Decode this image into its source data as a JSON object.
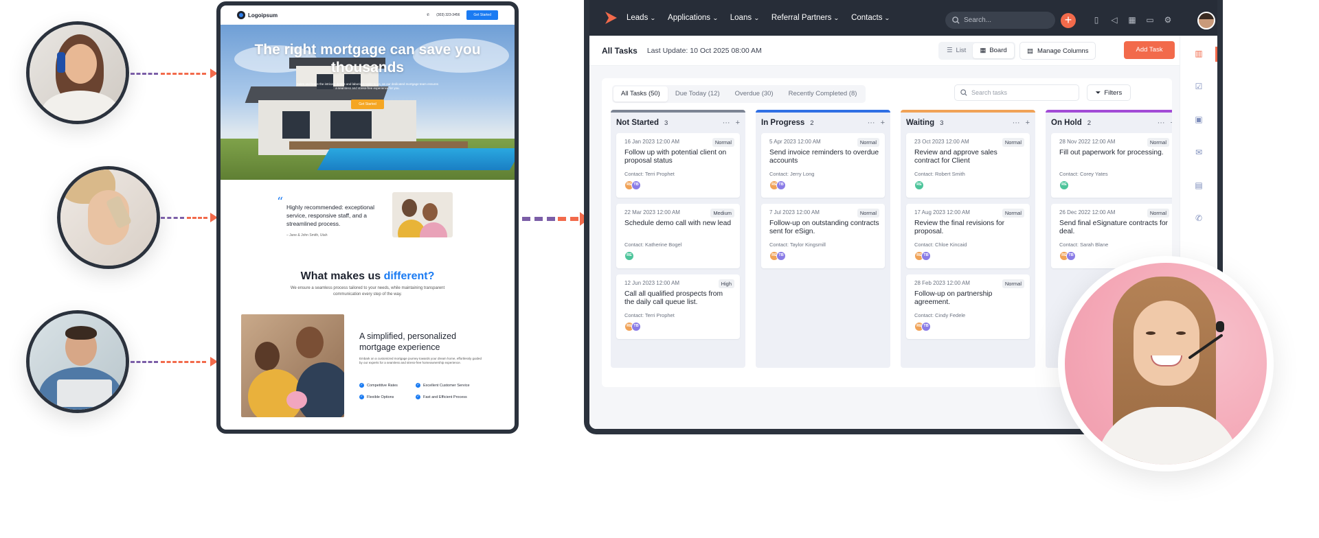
{
  "website": {
    "logo": "Logoipsum",
    "phone": "(303) 323-3456",
    "nav_cta": "Get Started",
    "hero_title": "The right mortgage can save you thousands",
    "hero_subtitle": "Sales and leave the intricate details and laborious tasks to us, as our dedicated mortgage team ensures a seamless and stress-free experience for you.",
    "hero_button": "Get Started",
    "testimonial_quote": "Highly recommended: exceptional service, responsive staff, and a streamlined process.",
    "testimonial_author": "– Jane & John Smith, Utah",
    "section_title_prefix": "What makes us",
    "section_title_accent": "different?",
    "section_subtitle": "We ensure a seamless process tailored to your needs, while maintaining transparent communication every step of the way.",
    "feature_title": "A simplified, personalized mortgage experience",
    "feature_desc": "Embark on a customized mortgage journey towards your dream home, effortlessly guided by our experts for a seamless and stress-free homeownership experience.",
    "features": [
      "Competitive Rates",
      "Excellent Customer Service",
      "Flexible Options",
      "Fast and Efficient Process"
    ]
  },
  "app": {
    "nav": [
      "Leads",
      "Applications",
      "Loans",
      "Referral Partners",
      "Contacts"
    ],
    "search_placeholder": "Search...",
    "page_title": "All Tasks",
    "last_update": "Last Update: 10 Oct 2025 08:00 AM",
    "view_list": "List",
    "view_board": "Board",
    "manage_columns": "Manage Columns",
    "add_task": "Add Task",
    "filter_tabs": [
      "All Tasks (50)",
      "Due Today (12)",
      "Overdue (30)",
      "Recently Completed (8)"
    ],
    "task_search_placeholder": "Search tasks",
    "filters": "Filters",
    "columns": [
      {
        "title": "Not Started",
        "count": "3",
        "color": "#7c8494",
        "tasks": [
          {
            "date": "16 Jan 2023 12:00 AM",
            "tag": "Normal",
            "title": "Follow up with potential client on proposal status",
            "contact": "Contact: Terri Prophet",
            "avatars": [
              "RE",
              "TB"
            ]
          },
          {
            "date": "22 Mar 2023 12:00 AM",
            "tag": "Medium",
            "title": "Schedule demo call with new lead",
            "contact": "Contact: Katherine Bogel",
            "avatars": [
              "RE"
            ]
          },
          {
            "date": "12 Jun 2023 12:00 AM",
            "tag": "High",
            "title": "Call all qualified prospects from the daily call queue list.",
            "contact": "Contact: Terri Prophet",
            "avatars": [
              "RE",
              "TB"
            ]
          }
        ]
      },
      {
        "title": "In Progress",
        "count": "2",
        "color": "#2f6fe4",
        "tasks": [
          {
            "date": "5 Apr 2023 12:00 AM",
            "tag": "Normal",
            "title": "Send invoice reminders to overdue accounts",
            "contact": "Contact: Jerry Long",
            "avatars": [
              "RE",
              "TB"
            ]
          },
          {
            "date": "7 Jul 2023 12:00 AM",
            "tag": "Normal",
            "title": "Follow-up on outstanding contracts sent for eSign.",
            "contact": "Contact: Taylor Kingsmill",
            "avatars": [
              "RE",
              "TB"
            ]
          }
        ]
      },
      {
        "title": "Waiting",
        "count": "3",
        "color": "#f0a257",
        "tasks": [
          {
            "date": "23 Oct 2023 12:00 AM",
            "tag": "Normal",
            "title": "Review and approve sales contract for Client",
            "contact": "Contact: Robert Smith",
            "avatars": [
              "RE"
            ]
          },
          {
            "date": "17 Aug 2023 12:00 AM",
            "tag": "Normal",
            "title": "Review the final revisions for proposal.",
            "contact": "Contact: Chloe Kincaid",
            "avatars": [
              "RE",
              "TB"
            ]
          },
          {
            "date": "28 Feb 2023 12:00 AM",
            "tag": "Normal",
            "title": "Follow-up on partnership agreement.",
            "contact": "Contact: Cindy Fedele",
            "avatars": [
              "RE",
              "TB"
            ]
          }
        ]
      },
      {
        "title": "On Hold",
        "count": "2",
        "color": "#a24bd6",
        "tasks": [
          {
            "date": "28 Nov 2022 12:00 AM",
            "tag": "Normal",
            "title": "Fill out paperwork for processing.",
            "contact": "Contact: Corey Yates",
            "avatars": [
              "RE"
            ]
          },
          {
            "date": "26 Dec 2022 12:00 AM",
            "tag": "Normal",
            "title": "Send final eSignature contracts for deal.",
            "contact": "Contact: Sarah Blane",
            "avatars": [
              "RE",
              "TB"
            ]
          }
        ]
      }
    ]
  },
  "colors": {
    "accent": "#f26a4b",
    "topbar": "#272d38",
    "link_blue": "#1b7bf2"
  }
}
